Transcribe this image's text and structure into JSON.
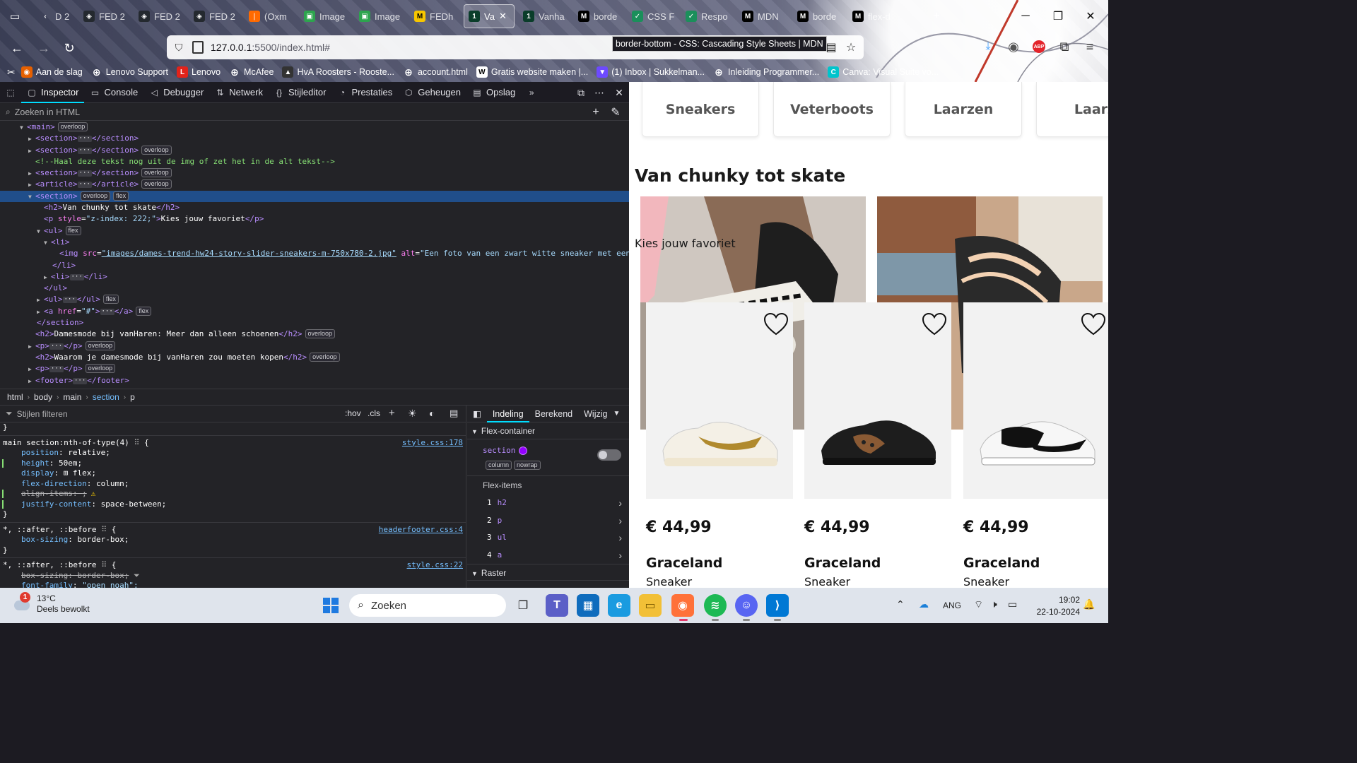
{
  "browser": {
    "tabs": [
      {
        "label": "D 2",
        "icon": "back-icon"
      },
      {
        "label": "FED 2",
        "icon": "github-icon"
      },
      {
        "label": "FED 2",
        "icon": "github-icon"
      },
      {
        "label": "FED 2",
        "icon": "github-icon"
      },
      {
        "label": "(Oxm",
        "icon": "orange-icon"
      },
      {
        "label": "Image",
        "icon": "green-image-icon"
      },
      {
        "label": "Image",
        "icon": "green-image-icon"
      },
      {
        "label": "FEDh",
        "icon": "yellow-m-icon"
      },
      {
        "label": "Va",
        "icon": "terminal-icon",
        "active": true
      },
      {
        "label": "Vanha",
        "icon": "terminal-icon"
      },
      {
        "label": "borde",
        "icon": "mdn-icon"
      },
      {
        "label": "CSS F",
        "icon": "green-icon"
      },
      {
        "label": "Respo",
        "icon": "green-icon"
      },
      {
        "label": "MDN",
        "icon": "mdn-icon"
      },
      {
        "label": "borde",
        "icon": "mdn-icon"
      },
      {
        "label": "flex-d",
        "icon": "mdn-icon"
      }
    ],
    "url_host": "127.0.0.1",
    "url_rest": ":5500/index.html#",
    "tooltip": "border-bottom - CSS: Cascading Style Sheets | MDN",
    "bookmarks": [
      {
        "label": "Aan de slag",
        "icon": "firefox-icon",
        "color": "#e66000"
      },
      {
        "label": "Lenovo Support",
        "icon": "globe-icon",
        "color": "#ffffff"
      },
      {
        "label": "Lenovo",
        "icon": "lenovo-icon",
        "color": "#e2231a"
      },
      {
        "label": "McAfee",
        "icon": "globe-icon",
        "color": "#ffffff"
      },
      {
        "label": "HvA Roosters - Rooste...",
        "icon": "hat-icon",
        "color": "#333333"
      },
      {
        "label": "account.html",
        "icon": "globe-icon",
        "color": "#ffffff"
      },
      {
        "label": "Gratis website maken |...",
        "icon": "wix-icon",
        "color": "#ffffff"
      },
      {
        "label": "(1) Inbox | Sukkelman...",
        "icon": "proton-icon",
        "color": "#6d4aff"
      },
      {
        "label": "Inleiding Programmer...",
        "icon": "globe-icon",
        "color": "#ffffff"
      },
      {
        "label": "Canva: Visual Suite vo...",
        "icon": "canva-icon",
        "color": "#00c4cc"
      }
    ]
  },
  "devtools": {
    "tabs": [
      {
        "label": "Inspector",
        "icon": "inspector-icon",
        "active": true
      },
      {
        "label": "Console",
        "icon": "console-icon"
      },
      {
        "label": "Debugger",
        "icon": "debugger-icon"
      },
      {
        "label": "Netwerk",
        "icon": "network-icon"
      },
      {
        "label": "Stijleditor",
        "icon": "style-editor-icon"
      },
      {
        "label": "Prestaties",
        "icon": "performance-icon"
      },
      {
        "label": "Geheugen",
        "icon": "memory-icon"
      },
      {
        "label": "Opslag",
        "icon": "storage-icon"
      }
    ],
    "search_placeholder": "Zoeken in HTML",
    "badge_overloop": "overloop",
    "badge_flex": "flex",
    "dom": {
      "main": "main",
      "section": "section",
      "article": "article",
      "ul": "ul",
      "li": "li",
      "a": "a",
      "h2": "h2",
      "p": "p",
      "img": "img",
      "footer": "footer",
      "comment": "<!--Haal deze tekst nog uit de img of zet het in de alt tekst-->",
      "h2_text": "Van chunky tot skate",
      "p_style_attr": "style",
      "p_style_val": "\"z-index: 222;\"",
      "p_text": "Kies jouw favoriet",
      "img_src_attr": "src",
      "img_src_val": "\"images/dames-trend-hw24-story-slider-sneakers-m-750x780-2.jpg\"",
      "img_alt_attr": "alt",
      "img_alt_val": "\"Een foto van een zwart witte sneaker met een",
      "a_href_attr": "href",
      "a_href_val": "\"#\"",
      "h2b_text": "Damesmode bij vanHaren: Meer dan alleen schoenen",
      "h2c_text": "Waarom je damesmode bij vanHaren zou moeten kopen",
      "ellipsis": "···"
    },
    "breadcrumbs": [
      "html",
      "body",
      "main",
      "section",
      "p"
    ],
    "styles_filter_placeholder": "Stijlen filteren",
    "styles_toolbar": {
      "hov": ":hov",
      "cls": ".cls"
    },
    "rules": {
      "r0_close": "}",
      "r1_selector": "main section:nth-of-type(4)",
      "r1_src": "style.css:178",
      "r1_props": [
        {
          "name": "position",
          "value": "relative;"
        },
        {
          "name": "height",
          "value": "50em;"
        },
        {
          "name": "display",
          "value": "flex;"
        },
        {
          "name": "flex-direction",
          "value": "column;"
        },
        {
          "name": "align-items",
          "value": ";"
        },
        {
          "name": "justify-content",
          "value": "space-between;"
        }
      ],
      "r2_selector": "*, ::after, ::before",
      "r2_src": "headerfooter.css:4",
      "r2_prop": "box-sizing",
      "r2_val": "border-box;",
      "r3_selector": "*, ::after, ::before",
      "r3_src": "style.css:22",
      "r3_prop1": "box-sizing: border-box;",
      "r3_prop2": "font-family",
      "r3_val2": "\"open noah\";",
      "open_brace": "{",
      "close_brace": "}"
    },
    "layout": {
      "tabs": [
        "Indeling",
        "Berekend",
        "Wijzig"
      ],
      "flex_container_heading": "Flex-container",
      "container_name": "section",
      "tag_column": "column",
      "tag_nowrap": "nowrap",
      "flex_items_heading": "Flex-items",
      "flex_items": [
        {
          "num": "1",
          "name": "h2"
        },
        {
          "num": "2",
          "name": "p"
        },
        {
          "num": "3",
          "name": "ul"
        },
        {
          "num": "4",
          "name": "a"
        }
      ],
      "grid_heading": "Raster"
    }
  },
  "page": {
    "categories": [
      "Sneakers",
      "Veterboots",
      "Laarzen",
      "Laarz"
    ],
    "title": "Van chunky tot skate",
    "subtitle": "Kies jouw favoriet",
    "products": [
      {
        "price": "€ 44,99",
        "name": "Graceland",
        "type": "Sneaker"
      },
      {
        "price": "€ 44,99",
        "name": "Graceland",
        "type": "Sneaker"
      },
      {
        "price": "€ 44,99",
        "name": "Graceland",
        "type": "Sneaker"
      }
    ]
  },
  "taskbar": {
    "temperature": "13°C",
    "weather": "Deels bewolkt",
    "weather_badge": "1",
    "search_label": "Zoeken",
    "language": "ANG",
    "time": "19:02",
    "date": "22-10-2024"
  }
}
